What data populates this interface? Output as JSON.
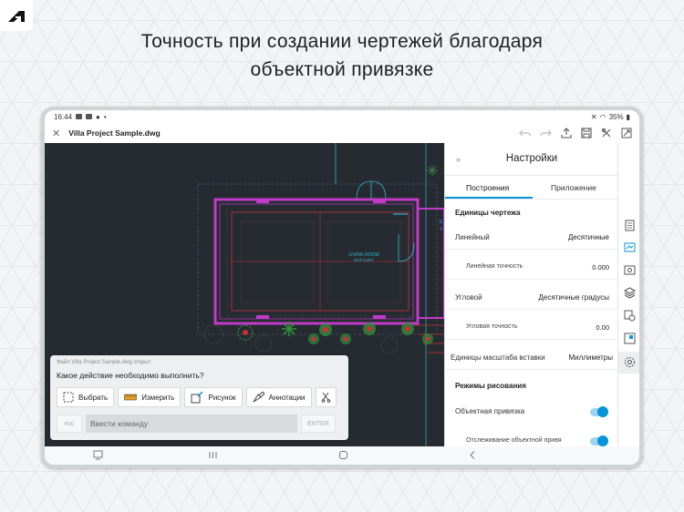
{
  "headline": {
    "line1": "Точность при создании чертежей благодаря",
    "line2": "объектной привязке"
  },
  "status_bar": {
    "time": "16:44",
    "battery": "35%"
  },
  "app_bar": {
    "close_icon": "close-icon",
    "file_title": "Villa Project Sample.dwg"
  },
  "drawing": {
    "room_name": "LIVING ROOM",
    "room_size": "25'0\"x15'0\"",
    "partial_label_1": "E",
    "partial_label_2": "V"
  },
  "command_panel": {
    "file_opened": "Файл Villa Project Sample.dwg открыт",
    "question": "Какое действие необходимо выполнить?",
    "actions": [
      {
        "label": "Выбрать",
        "icon": "select-icon"
      },
      {
        "label": "Измерить",
        "icon": "measure-icon"
      },
      {
        "label": "Рисунок",
        "icon": "draw-icon"
      },
      {
        "label": "Аннотации",
        "icon": "annotate-icon"
      }
    ],
    "esc_label": "esc",
    "input_placeholder": "Ввести команду",
    "enter_label": "ENTER"
  },
  "settings": {
    "title": "Настройки",
    "tabs": [
      "Построения",
      "Приложение"
    ],
    "active_tab": "Построения",
    "units_section": "Единицы чертежа",
    "linear_label": "Линейный",
    "linear_value": "Десятичные",
    "linear_precision_label": "Линейная точность",
    "linear_precision_value": "0.000",
    "angular_label": "Угловой",
    "angular_value": "Десятичные градусы",
    "angular_precision_label": "Угловая точность",
    "angular_precision_value": "0.00",
    "insert_units_label": "Единицы масштаба вставки",
    "insert_units_value": "Миллиметры",
    "draw_modes_section": "Режимы рисования",
    "object_snap_label": "Объектная привязка",
    "object_snap_on": true,
    "snap_tracking_label": "Отслеживание объектной привя",
    "snap_tracking_on": true
  },
  "colors": {
    "accent": "#0696d7",
    "canvas": "#262b32",
    "wall": "#c23ac8",
    "cyan_line": "#2fb8d2",
    "red_line": "#c83232",
    "plant": "#2f8f3a"
  }
}
